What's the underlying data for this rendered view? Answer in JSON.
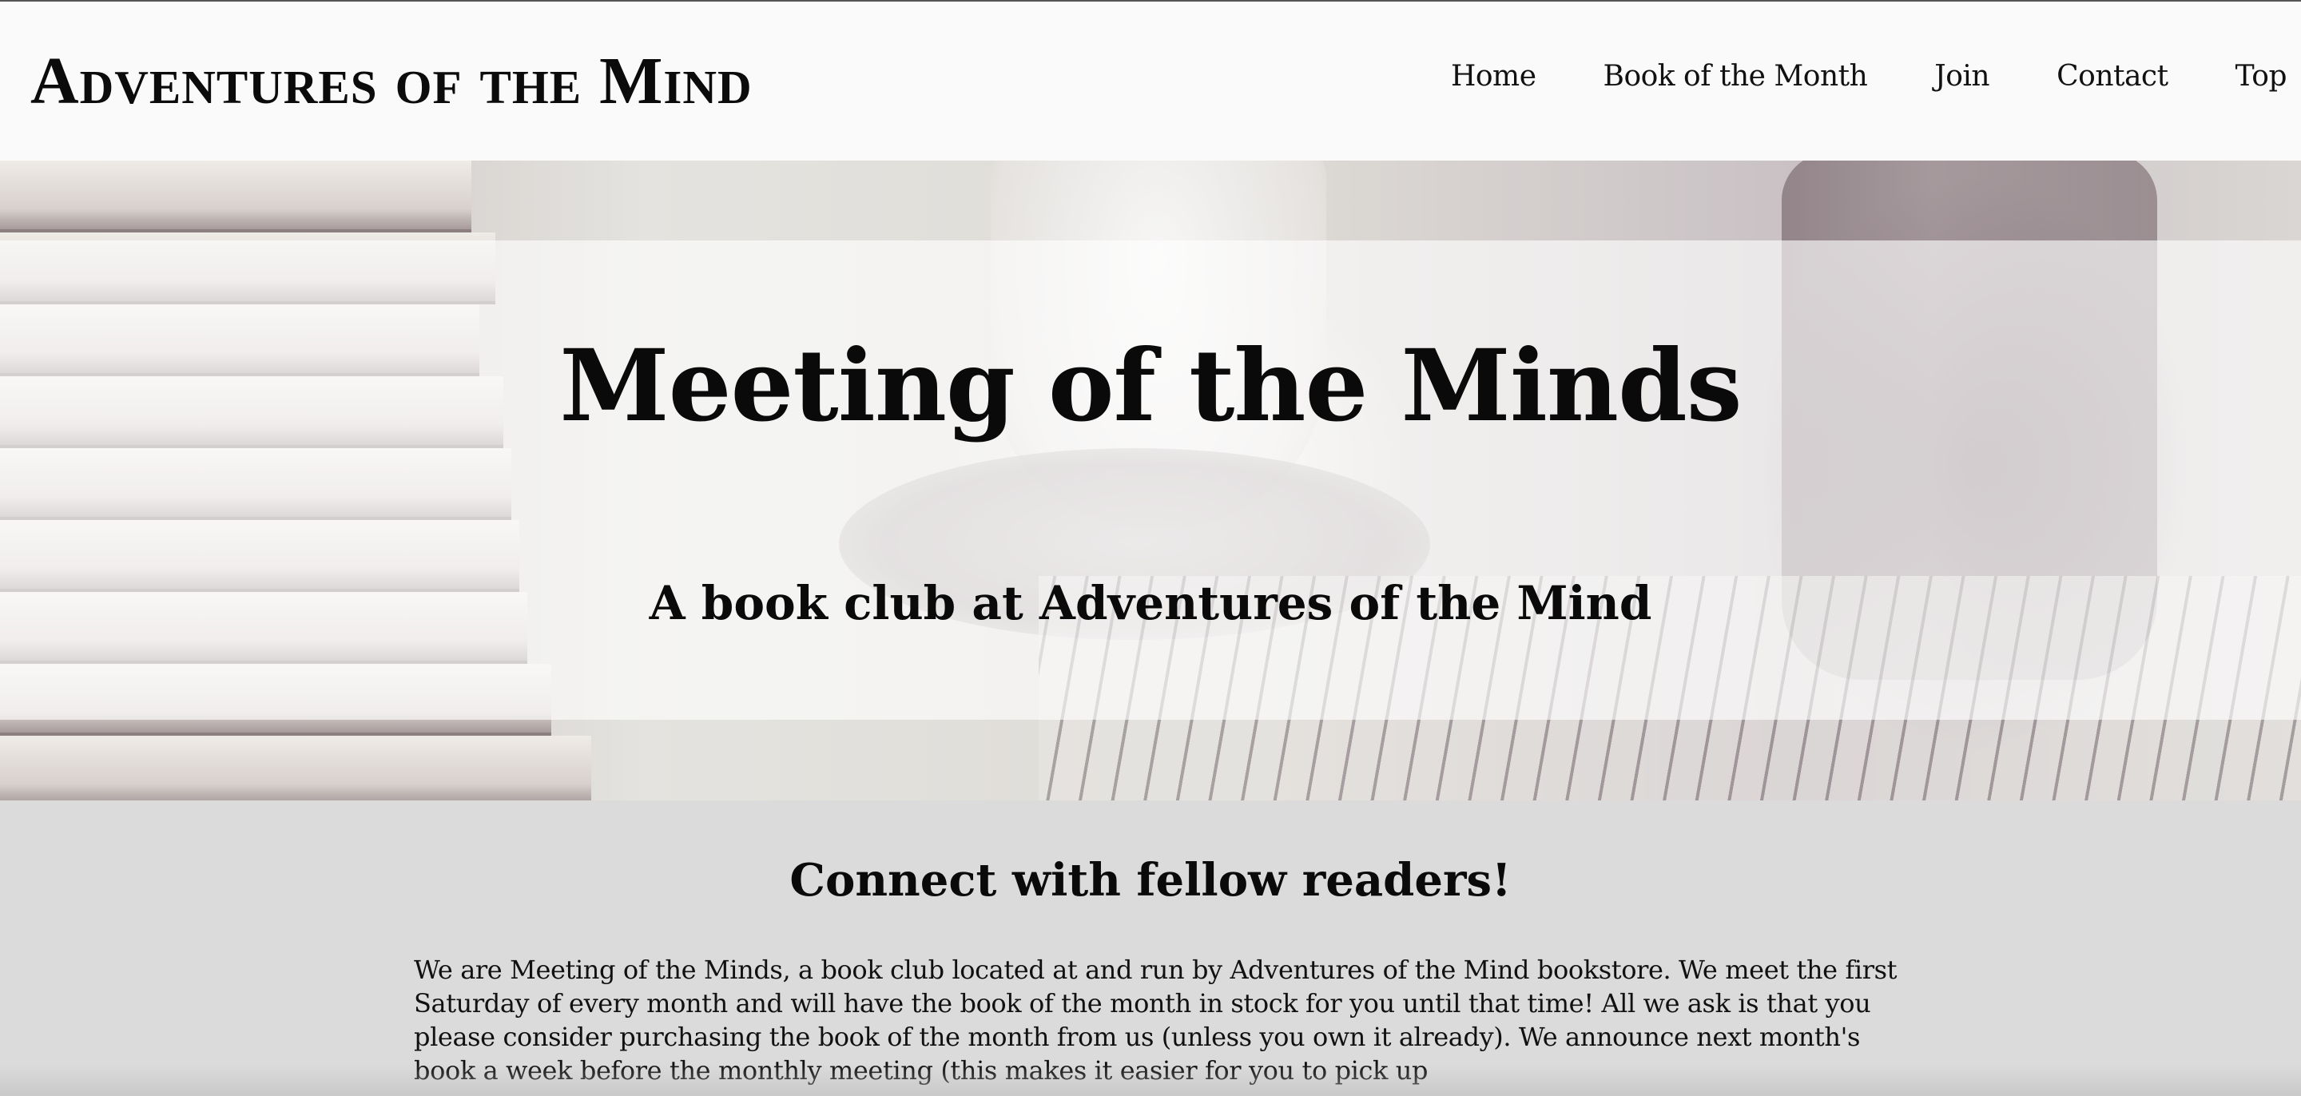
{
  "header": {
    "site_title": "Adventures of the Mind",
    "nav": [
      {
        "label": "Home"
      },
      {
        "label": "Book of the Month"
      },
      {
        "label": "Join"
      },
      {
        "label": "Contact"
      },
      {
        "label": "Top"
      }
    ]
  },
  "hero": {
    "title": "Meeting of the Minds",
    "subtitle": "A book club at Adventures of the Mind"
  },
  "main": {
    "heading": "Connect with fellow readers!",
    "intro": "We are Meeting of the Minds, a book club located at and run by Adventures of the Mind bookstore. We meet the first Saturday of every month and will have the book of the month in stock for you until that time! All we ask is that you please consider purchasing the book of the month from us (unless you own it already). We announce next month's book a week before the monthly meeting (this makes it easier for you to pick up"
  },
  "colors": {
    "header_bg": "#fafafb",
    "page_bg": "#dcdbdc",
    "text": "#0a0a0a"
  }
}
